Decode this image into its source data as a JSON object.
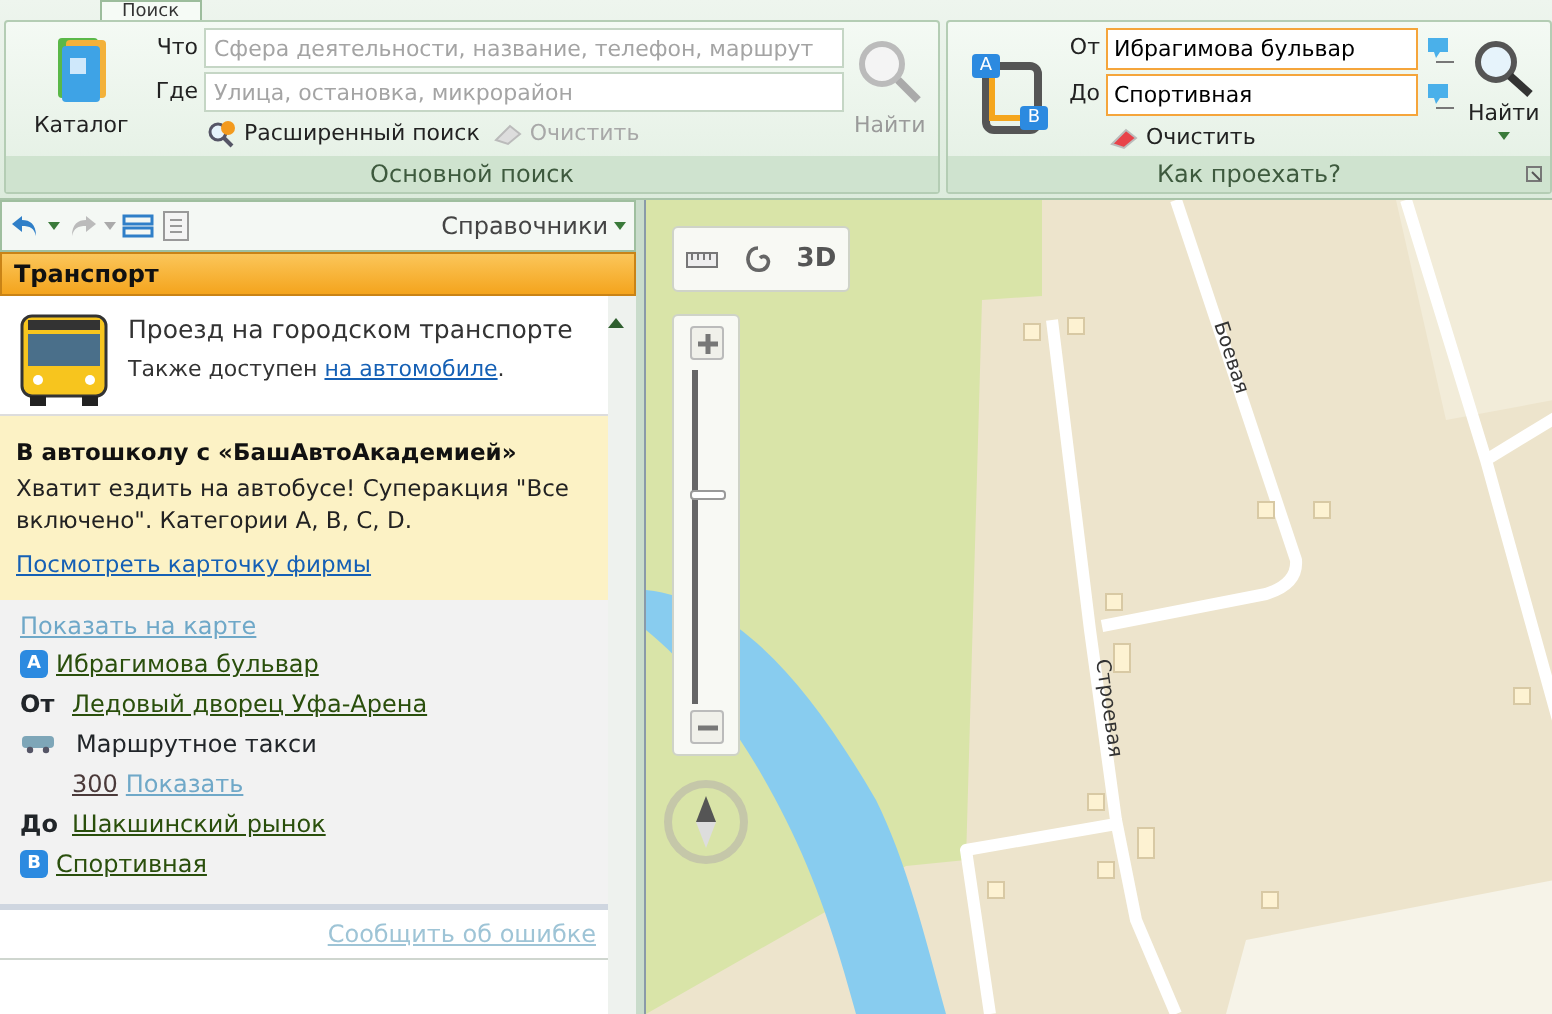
{
  "ribbon_tab": {
    "label": "Поиск",
    "selected": true
  },
  "search_group": {
    "catalog": "Каталог",
    "what_label": "Что",
    "what_placeholder": "Сфера деятельности, название, телефон, маршрут",
    "where_label": "Где",
    "where_placeholder": "Улица, остановка, микрорайон",
    "advanced": "Расширенный поиск",
    "clear": {
      "label": "Очистить",
      "disabled": true
    },
    "find": {
      "label": "Найти",
      "disabled": true
    },
    "caption": "Основной поиск"
  },
  "route_group": {
    "icon_marks": [
      "A",
      "B"
    ],
    "from_label": "От",
    "from_value": "Ибрагимова бульвар",
    "to_label": "До",
    "to_value": "Спортивная",
    "clear": {
      "label": "Очистить",
      "disabled": false
    },
    "find": {
      "label": "Найти",
      "disabled": false
    },
    "caption": "Как проехать?"
  },
  "panel": {
    "directories": "Справочники",
    "header": "Транспорт",
    "intro": {
      "title": "Проезд на городском транспорте",
      "note": "Также доступен ",
      "note_link": "на автомобиле",
      "note_end": "."
    },
    "ad": {
      "title": "В автошколу с «БашАвтоАкадемией»",
      "text": "Хватит ездить на автобусе! Суперакция \"Все включено\". Категории A, B, C, D.",
      "link": "Посмотреть карточку фирмы"
    },
    "route": {
      "show_on_map": "Показать на карте",
      "steps": [
        {
          "kind": "point",
          "marker": "A",
          "text": "Ибрагимова бульвар"
        },
        {
          "kind": "stop",
          "label": "От",
          "text": "Ледовый дворец Уфа-Арена"
        },
        {
          "kind": "transport",
          "text": "Маршрутное такси"
        },
        {
          "kind": "number",
          "number": "300",
          "link": "Показать"
        },
        {
          "kind": "stop",
          "label": "До",
          "text": "Шакшинский рынок"
        },
        {
          "kind": "point",
          "marker": "B",
          "text": "Спортивная"
        }
      ]
    },
    "report": "Сообщить об ошибке"
  },
  "map": {
    "mode_3d": "3D",
    "zoom": {
      "level": 0.62
    },
    "streets": [
      "Боевая",
      "Строевая"
    ]
  }
}
